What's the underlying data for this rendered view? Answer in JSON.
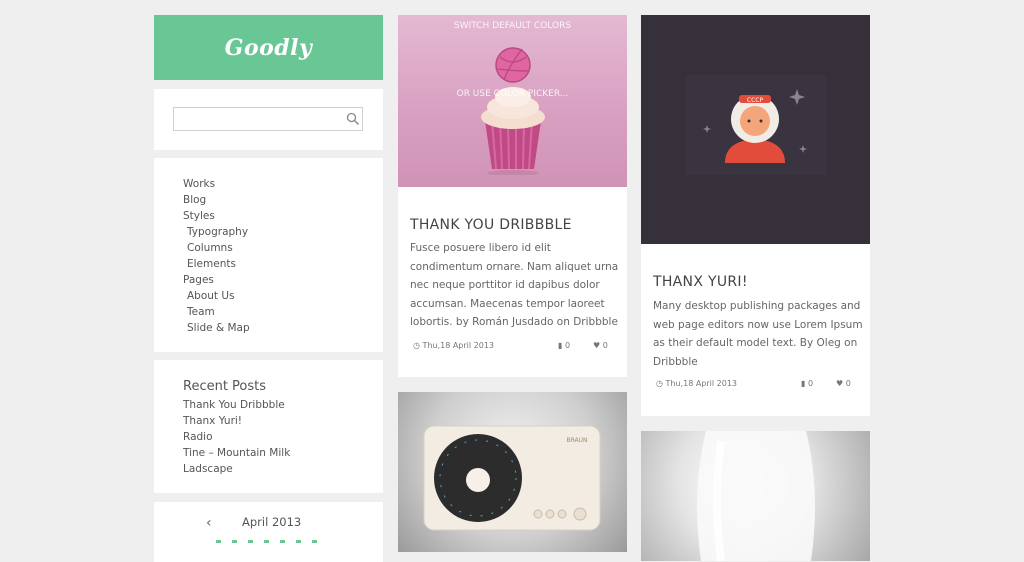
{
  "logo": {
    "text": "Goodly"
  },
  "search": {
    "placeholder": ""
  },
  "menu": {
    "items": [
      {
        "label": "Works"
      },
      {
        "label": "Blog"
      },
      {
        "label": "Styles"
      },
      {
        "label": "Typography"
      },
      {
        "label": "Columns"
      },
      {
        "label": "Elements"
      },
      {
        "label": "Pages"
      },
      {
        "label": "About Us"
      },
      {
        "label": "Team"
      },
      {
        "label": "Slide & Map"
      }
    ]
  },
  "recent_posts": {
    "title": "Recent Posts",
    "items": [
      {
        "label": "Thank You Dribbble"
      },
      {
        "label": "Thanx Yuri!"
      },
      {
        "label": "Radio"
      },
      {
        "label": "Tine – Mountain Milk"
      },
      {
        "label": "Ladscape"
      }
    ]
  },
  "calendar": {
    "month": "April 2013",
    "prev_icon": "chevron-left-icon"
  },
  "posts": [
    {
      "overlay_top": "SWITCH DEFAULT COLORS",
      "overlay_bottom": "OR USE COLOR PICKER...",
      "title": "THANK YOU DRIBBBLE",
      "body": [
        "Fusce posuere libero id elit",
        "condimentum ornare. Nam aliquet urna",
        "nec neque porttitor id dapibus dolor",
        "accumsan. Maecenas tempor laoreet",
        "lobortis.   by Román Jusdado on Dribbble"
      ],
      "date": "Thu,18 April 2013",
      "comments": "0",
      "likes": "0"
    },
    {
      "title": "THANX YURI!",
      "body": [
        "Many desktop publishing packages and",
        "web page editors now use Lorem Ipsum",
        "as their default model text.  By Oleg on",
        "Dribbble"
      ],
      "date": "Thu,18 April 2013",
      "comments": "0",
      "likes": "0",
      "badge": "CCCP"
    },
    {
      "brand": "BRAUN"
    }
  ],
  "colors": {
    "accent": "#69c796",
    "background": "#efefef"
  }
}
